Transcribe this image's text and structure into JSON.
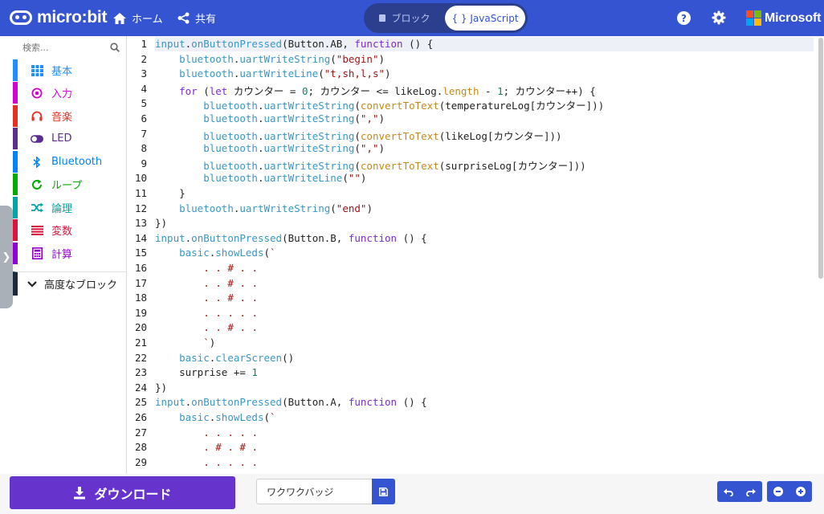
{
  "app": {
    "logo": "micro:bit",
    "home_label": "ホーム",
    "share_label": "共有",
    "mode_blocks_label": "ブロック",
    "mode_js_label": "{ } JavaScript",
    "brand": "Microsoft"
  },
  "toolbox": {
    "search_placeholder": "検索...",
    "categories": [
      {
        "label": "基本",
        "color": "#1e90ff",
        "icon": "grid-icon"
      },
      {
        "label": "入力",
        "color": "#d400d4",
        "icon": "target-icon"
      },
      {
        "label": "音楽",
        "color": "#e63022",
        "icon": "headphones-icon"
      },
      {
        "label": "LED",
        "color": "#5c2d91",
        "icon": "toggle-icon"
      },
      {
        "label": "Bluetooth",
        "color": "#0082fb",
        "icon": "bluetooth-icon"
      },
      {
        "label": "ループ",
        "color": "#00aa00",
        "icon": "loop-icon"
      },
      {
        "label": "論理",
        "color": "#00a4a6",
        "icon": "shuffle-icon"
      },
      {
        "label": "変数",
        "color": "#dc143c",
        "icon": "list-icon"
      },
      {
        "label": "計算",
        "color": "#9400d3",
        "icon": "calculator-icon"
      }
    ],
    "advanced_label": "高度なブロック"
  },
  "editor": {
    "line_numbers": [
      "1",
      "2",
      "3",
      "4",
      "5",
      "6",
      "7",
      "8",
      "9",
      "10",
      "11",
      "12",
      "13",
      "14",
      "15",
      "16",
      "17",
      "18",
      "19",
      "20",
      "21",
      "22",
      "23",
      "24",
      "25",
      "26",
      "27",
      "28",
      "29"
    ],
    "code_lines": [
      "input.onButtonPressed(Button.AB, function () {",
      "    bluetooth.uartWriteString(\"begin\")",
      "    bluetooth.uartWriteLine(\"t,sh,l,s\")",
      "    for (let カウンター = 0; カウンター <= likeLog.length - 1; カウンター++) {",
      "        bluetooth.uartWriteString(convertToText(temperatureLog[カウンター]))",
      "        bluetooth.uartWriteString(\",\")",
      "        bluetooth.uartWriteString(convertToText(likeLog[カウンター]))",
      "        bluetooth.uartWriteString(\",\")",
      "        bluetooth.uartWriteString(convertToText(surpriseLog[カウンター]))",
      "        bluetooth.uartWriteLine(\"\")",
      "    }",
      "    bluetooth.uartWriteString(\"end\")",
      "})",
      "input.onButtonPressed(Button.B, function () {",
      "    basic.showLeds(`",
      "        . . # . .",
      "        . . # . .",
      "        . . # . .",
      "        . . . . .",
      "        . . # . .",
      "        `)",
      "    basic.clearScreen()",
      "    surprise += 1",
      "})",
      "input.onButtonPressed(Button.A, function () {",
      "    basic.showLeds(`",
      "        . . . . .",
      "        . # . # .",
      "        . . . . ."
    ]
  },
  "bottom": {
    "download_label": "ダウンロード",
    "project_name": "ワクワクバッジ"
  }
}
